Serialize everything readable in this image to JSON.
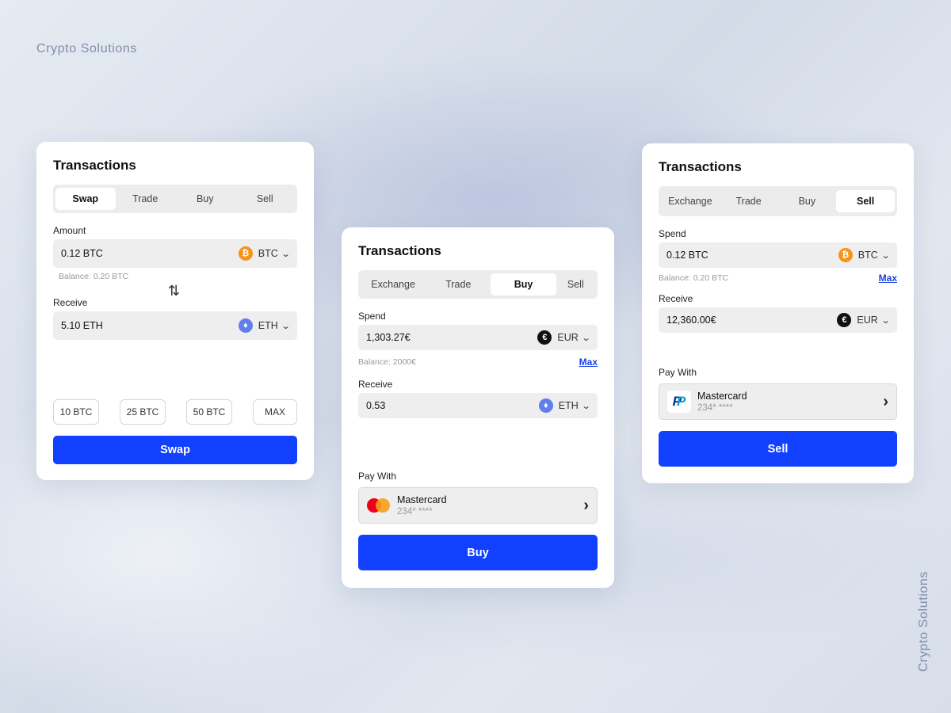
{
  "brand": {
    "title": "Crypto Solutions",
    "vertical_title": "Crypto Solutions"
  },
  "card_swap": {
    "title": "Transactions",
    "tabs": [
      {
        "label": "Swap",
        "active": true
      },
      {
        "label": "Trade",
        "active": false
      },
      {
        "label": "Buy",
        "active": false
      },
      {
        "label": "Sell",
        "active": false
      }
    ],
    "amount_label": "Amount",
    "amount_value": "0.12 BTC",
    "amount_currency": "BTC",
    "balance": "Balance: 0.20 BTC",
    "receive_label": "Receive",
    "receive_value": "5.10 ETH",
    "receive_currency": "ETH",
    "quick_amounts": [
      "10 BTC",
      "25 BTC",
      "50 BTC",
      "MAX"
    ],
    "button": "Swap"
  },
  "card_buy": {
    "title": "Transactions",
    "tabs": [
      {
        "label": "Exchange",
        "active": false
      },
      {
        "label": "Trade",
        "active": false
      },
      {
        "label": "Buy",
        "active": true
      },
      {
        "label": "Sell",
        "active": false
      }
    ],
    "spend_label": "Spend",
    "spend_value": "1,303.27€",
    "spend_currency": "EUR",
    "balance": "Balance: 2000€",
    "max_link": "Max",
    "receive_label": "Receive",
    "receive_value": "0.53",
    "receive_currency": "ETH",
    "pay_with_label": "Pay With",
    "payment_name": "Mastercard",
    "payment_number": "234* ****",
    "button": "Buy"
  },
  "card_sell": {
    "title": "Transactions",
    "tabs": [
      {
        "label": "Exchange",
        "active": false
      },
      {
        "label": "Trade",
        "active": false
      },
      {
        "label": "Buy",
        "active": false
      },
      {
        "label": "Sell",
        "active": true
      }
    ],
    "spend_label": "Spend",
    "spend_value": "0.12 BTC",
    "spend_currency": "BTC",
    "balance": "Balance: 0.20 BTC",
    "max_link": "Max",
    "receive_label": "Receive",
    "receive_value": "12,360.00€",
    "receive_currency": "EUR",
    "pay_with_label": "Pay With",
    "payment_name": "Mastercard",
    "payment_number": "234* ****",
    "button": "Sell"
  },
  "colors": {
    "accent": "#1240ff",
    "btc": "#f7931a",
    "eth": "#627eea",
    "link": "#1a3fe6"
  }
}
